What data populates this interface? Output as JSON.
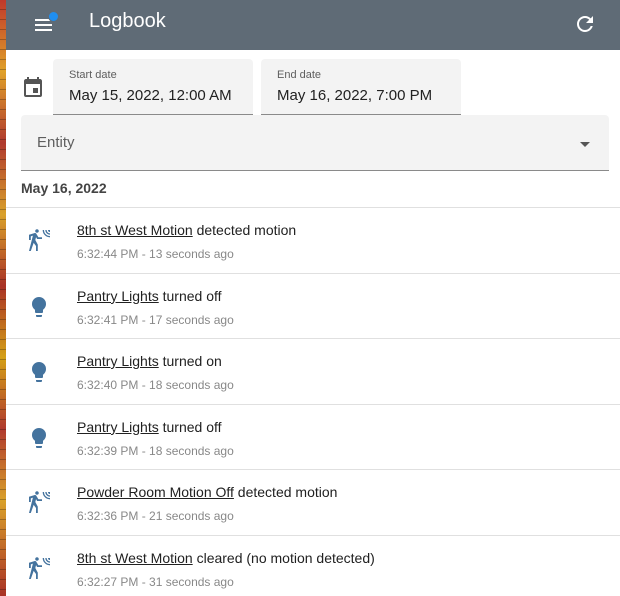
{
  "header": {
    "title": "Logbook",
    "menu_icon": "menu-icon",
    "refresh_icon": "refresh-icon",
    "badge_color": "#1f8ef0",
    "bar_color": "#5f6b76"
  },
  "filters": {
    "calendar_icon": "calendar-icon",
    "start_date": {
      "label": "Start date",
      "value": "May 15, 2022, 12:00 AM"
    },
    "end_date": {
      "label": "End date",
      "value": "May 16, 2022, 7:00 PM"
    },
    "entity": {
      "label": "Entity"
    }
  },
  "log": {
    "date_header": "May 16, 2022",
    "icon_color": "#44739e",
    "entries": [
      {
        "icon": "motion-sensor-icon",
        "entity": "8th st West Motion",
        "message": " detected motion",
        "time": "6:32:44 PM - 13 seconds ago"
      },
      {
        "icon": "lightbulb-icon",
        "entity": "Pantry Lights",
        "message": " turned off",
        "time": "6:32:41 PM - 17 seconds ago"
      },
      {
        "icon": "lightbulb-icon",
        "entity": "Pantry Lights",
        "message": " turned on",
        "time": "6:32:40 PM - 18 seconds ago"
      },
      {
        "icon": "lightbulb-icon",
        "entity": "Pantry Lights",
        "message": " turned off",
        "time": "6:32:39 PM - 18 seconds ago"
      },
      {
        "icon": "motion-sensor-icon",
        "entity": "Powder Room Motion Off",
        "message": " detected motion",
        "time": "6:32:36 PM - 21 seconds ago"
      },
      {
        "icon": "motion-sensor-icon",
        "entity": "8th st West Motion",
        "message": " cleared (no motion detected)",
        "time": "6:32:27 PM - 31 seconds ago"
      }
    ]
  }
}
